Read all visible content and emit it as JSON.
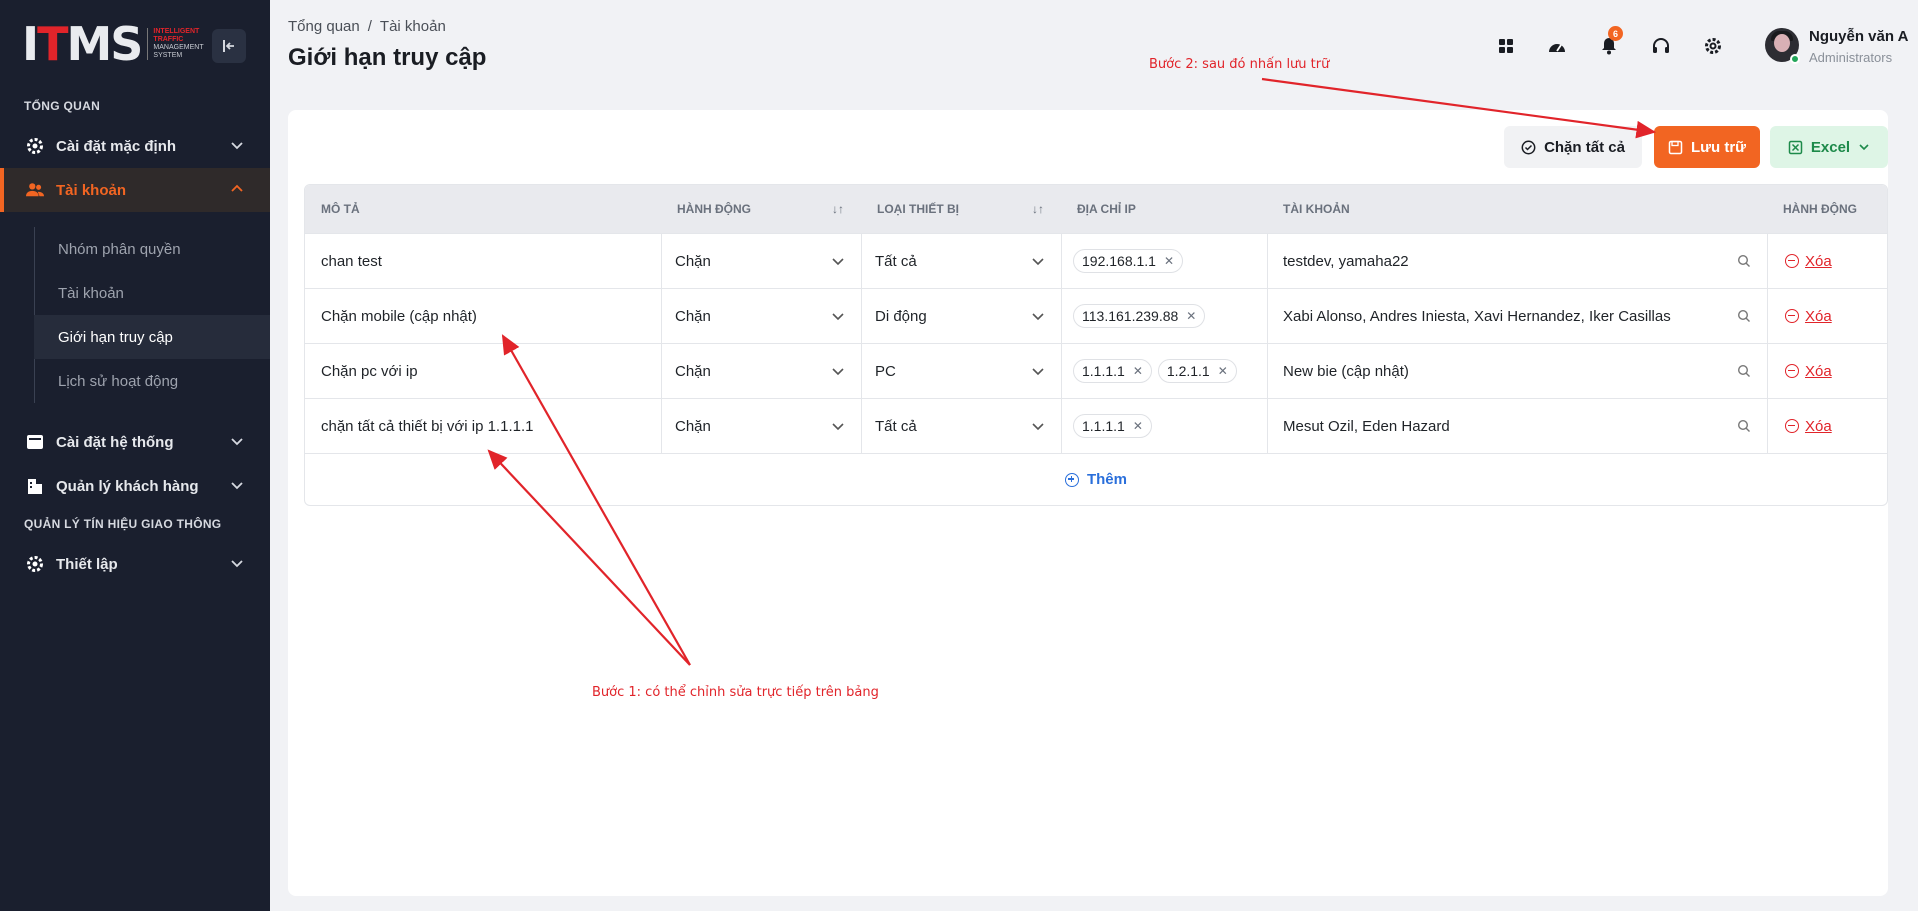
{
  "app": {
    "logo_text": "ITMS",
    "logo_sub": [
      "INTELLIGENT",
      "TRAFFIC",
      "MANAGEMENT",
      "SYSTEM"
    ]
  },
  "sidebar": {
    "section_overview": "TỔNG QUAN",
    "section_traffic": "QUẢN LÝ TÍN HIỆU GIAO THÔNG",
    "items": [
      {
        "label": "Cài đặt mặc định",
        "icon": "gear-icon"
      },
      {
        "label": "Tài khoản",
        "icon": "users-icon",
        "active": true
      },
      {
        "label": "Cài đặt hệ thống",
        "icon": "settings-panel-icon"
      },
      {
        "label": "Quản lý khách hàng",
        "icon": "building-icon"
      },
      {
        "label": "Thiết lập",
        "icon": "gear-icon"
      }
    ],
    "sub_items": [
      {
        "label": "Nhóm phân quyền"
      },
      {
        "label": "Tài khoản"
      },
      {
        "label": "Giới hạn truy cập",
        "active": true
      },
      {
        "label": "Lịch sử hoạt động"
      }
    ]
  },
  "header": {
    "breadcrumb": [
      "Tổng quan",
      "Tài khoản"
    ],
    "title": "Giới hạn truy cập",
    "notification_count": "6",
    "user": {
      "name": "Nguyễn văn A",
      "role": "Administrators"
    }
  },
  "toolbar": {
    "block_all": "Chặn tất cả",
    "save": "Lưu trữ",
    "excel": "Excel"
  },
  "table": {
    "columns": [
      "MÔ TẢ",
      "HÀNH ĐỘNG",
      "LOẠI THIẾT BỊ",
      "ĐỊA CHỈ IP",
      "TÀI KHOẢN",
      "HÀNH ĐỘNG"
    ],
    "rows": [
      {
        "desc": "chan test",
        "action": "Chặn",
        "device": "Tất cả",
        "ips": [
          "192.168.1.1"
        ],
        "accounts": "testdev, yamaha22",
        "delete": "Xóa"
      },
      {
        "desc": "Chặn mobile (cập nhật)",
        "action": "Chặn",
        "device": "Di động",
        "ips": [
          "113.161.239.88"
        ],
        "accounts": "Xabi Alonso, Andres Iniesta, Xavi Hernandez, Iker Casillas",
        "delete": "Xóa"
      },
      {
        "desc": "Chặn pc với ip",
        "action": "Chặn",
        "device": "PC",
        "ips": [
          "1.1.1.1",
          "1.2.1.1"
        ],
        "accounts": "New bie (cập nhật)",
        "delete": "Xóa"
      },
      {
        "desc": "chặn tất cả thiết bị với ip 1.1.1.1",
        "action": "Chặn",
        "device": "Tất cả",
        "ips": [
          "1.1.1.1"
        ],
        "accounts": "Mesut Ozil, Eden Hazard",
        "delete": "Xóa"
      }
    ],
    "add_label": "Thêm"
  },
  "annotations": {
    "step1": "Bước 1: có thể chỉnh sửa trực tiếp trên bảng",
    "step2": "Bước 2: sau đó nhấn lưu trữ"
  },
  "colors": {
    "sidebar_bg": "#1a1f2e",
    "accent": "#f26522",
    "annotation": "#e1242a",
    "link_blue": "#2a6fdb"
  }
}
